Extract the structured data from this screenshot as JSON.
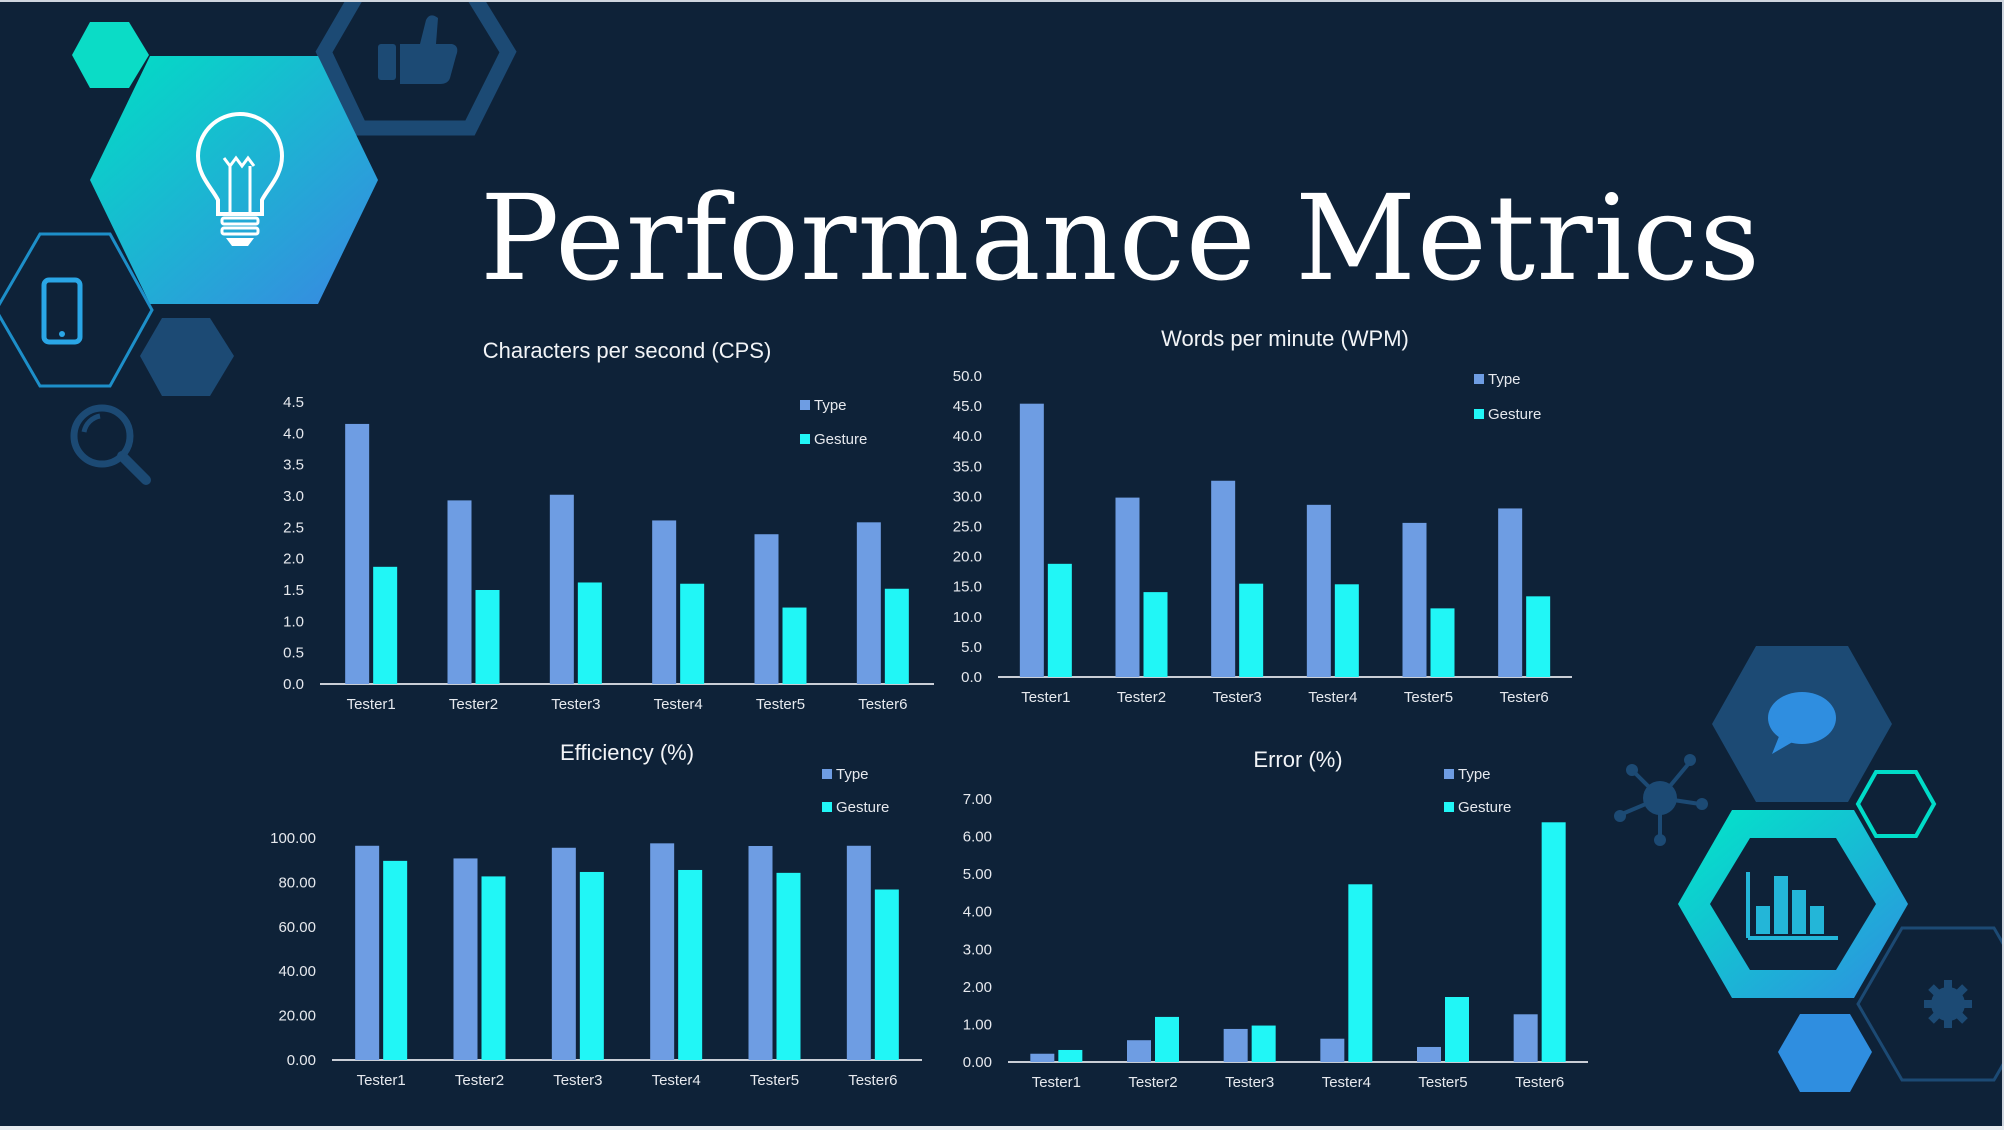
{
  "slide": {
    "title": "Performance Metrics"
  },
  "icons": [
    "lightbulb-icon",
    "thumbs-up-icon",
    "smartphone-icon",
    "magnifier-icon",
    "speech-bubble-icon",
    "network-icon",
    "bar-chart-icon",
    "gear-icon"
  ],
  "colors": {
    "background": "#0e2238",
    "type_series": "#6e9de3",
    "gesture_series": "#21f6f6",
    "accent_teal": "#00dcc8",
    "accent_blue": "#2f8ee0",
    "dark_hex": "#1c4a74"
  },
  "chart_data": [
    {
      "id": "cps",
      "type": "bar",
      "title": "Characters per second (CPS)",
      "categories": [
        "Tester1",
        "Tester2",
        "Tester3",
        "Tester4",
        "Tester5",
        "Tester6"
      ],
      "series": [
        {
          "name": "Type",
          "values": [
            4.15,
            2.93,
            3.02,
            2.61,
            2.39,
            2.58
          ]
        },
        {
          "name": "Gesture",
          "values": [
            1.87,
            1.5,
            1.62,
            1.6,
            1.22,
            1.52
          ]
        }
      ],
      "ylim": [
        0,
        4.5
      ],
      "yticks": [
        "0.0",
        "0.5",
        "1.0",
        "1.5",
        "2.0",
        "2.5",
        "3.0",
        "3.5",
        "4.0",
        "4.5"
      ],
      "grid": false,
      "legend": "top-right"
    },
    {
      "id": "wpm",
      "type": "bar",
      "title": "Words per minute (WPM)",
      "categories": [
        "Tester1",
        "Tester2",
        "Tester3",
        "Tester4",
        "Tester5",
        "Tester6"
      ],
      "series": [
        {
          "name": "Type",
          "values": [
            45.4,
            29.8,
            32.6,
            28.6,
            25.6,
            28.0
          ]
        },
        {
          "name": "Gesture",
          "values": [
            18.8,
            14.1,
            15.5,
            15.4,
            11.4,
            13.4
          ]
        }
      ],
      "ylim": [
        0,
        50
      ],
      "yticks": [
        "0.0",
        "5.0",
        "10.0",
        "15.0",
        "20.0",
        "25.0",
        "30.0",
        "35.0",
        "40.0",
        "45.0",
        "50.0"
      ],
      "grid": false,
      "legend": "top-right"
    },
    {
      "id": "efficiency",
      "type": "bar",
      "title": "Efficiency (%)",
      "categories": [
        "Tester1",
        "Tester2",
        "Tester3",
        "Tester4",
        "Tester5",
        "Tester6"
      ],
      "series": [
        {
          "name": "Type",
          "values": [
            96.5,
            90.8,
            95.6,
            97.6,
            96.4,
            96.5
          ]
        },
        {
          "name": "Gesture",
          "values": [
            89.7,
            82.7,
            84.7,
            85.6,
            84.3,
            76.8
          ]
        }
      ],
      "ylim": [
        0,
        100
      ],
      "yticks": [
        "0.00",
        "20.00",
        "40.00",
        "60.00",
        "80.00",
        "100.00"
      ],
      "grid": false,
      "legend": "top-right"
    },
    {
      "id": "error",
      "type": "bar",
      "title": "Error (%)",
      "categories": [
        "Tester1",
        "Tester2",
        "Tester3",
        "Tester4",
        "Tester5",
        "Tester6"
      ],
      "series": [
        {
          "name": "Type",
          "values": [
            0.22,
            0.58,
            0.88,
            0.62,
            0.4,
            1.27
          ]
        },
        {
          "name": "Gesture",
          "values": [
            0.32,
            1.2,
            0.97,
            4.73,
            1.73,
            6.38
          ]
        }
      ],
      "ylim": [
        0,
        7
      ],
      "yticks": [
        "0.00",
        "1.00",
        "2.00",
        "3.00",
        "4.00",
        "5.00",
        "6.00",
        "7.00"
      ],
      "grid": false,
      "legend": "top-right"
    }
  ]
}
